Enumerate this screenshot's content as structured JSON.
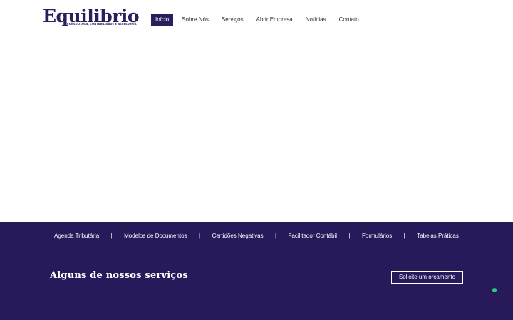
{
  "logo": {
    "word": "Equilibrio",
    "tagline": "CONSULTORIA, CONTABILIDADE E ASSESSORIA"
  },
  "nav": {
    "items": [
      {
        "label": "Início"
      },
      {
        "label": "Sobre Nós"
      },
      {
        "label": "Serviços"
      },
      {
        "label": "Abrir Empresa"
      },
      {
        "label": "Notícias"
      },
      {
        "label": "Contato"
      }
    ],
    "active_index": 0
  },
  "quicklinks": {
    "items": [
      {
        "label": "Agenda Tributária"
      },
      {
        "label": "Modelos de Documentos"
      },
      {
        "label": "Certidões Negativas"
      },
      {
        "label": "Facilitador Contábil"
      },
      {
        "label": "Formulários"
      },
      {
        "label": "Tabelas Práticas"
      }
    ],
    "separator": "|"
  },
  "services": {
    "title": "Alguns de nossos serviços",
    "quote_button": "Solicite um orçamento"
  },
  "colors": {
    "brand": "#2a1f5c",
    "band": "#27195a",
    "status": "#2ecc71"
  },
  "icons": {
    "status": "online-dot-icon"
  }
}
